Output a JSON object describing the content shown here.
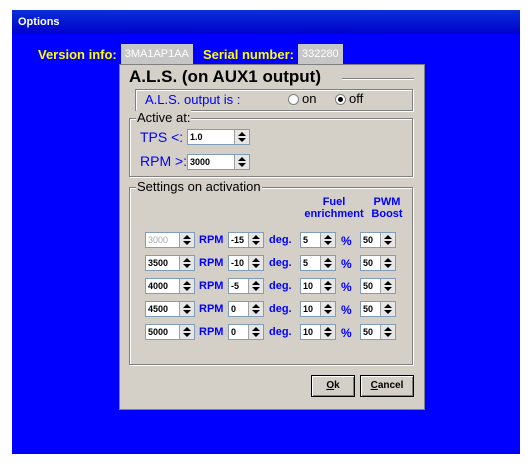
{
  "window": {
    "title": "Options"
  },
  "version": {
    "label": "Version info:",
    "value": "3MA1AP1AA"
  },
  "serial": {
    "label": "Serial number:",
    "value": "332280"
  },
  "als": {
    "title": "A.L.S. (on AUX1 output)",
    "output_label": "A.L.S. output is :",
    "on_label": "on",
    "off_label": "off",
    "selected": "off"
  },
  "active": {
    "legend": "Active at:",
    "tps_label": "TPS <:",
    "tps_value": "1.0",
    "rpm_label": "RPM >:",
    "rpm_value": "3000"
  },
  "settings": {
    "legend": "Settings on activation",
    "hdr_fuel_1": "Fuel",
    "hdr_fuel_2": "enrichment",
    "hdr_pwm_1": "PWM",
    "hdr_pwm_2": "Boost",
    "unit_rpm": "RPM",
    "unit_deg": "deg.",
    "unit_pct": "%",
    "rows": [
      {
        "rpm": "3000",
        "deg": "-15",
        "fuel": "5",
        "pwm": "50"
      },
      {
        "rpm": "3500",
        "deg": "-10",
        "fuel": "5",
        "pwm": "50"
      },
      {
        "rpm": "4000",
        "deg": "-5",
        "fuel": "10",
        "pwm": "50"
      },
      {
        "rpm": "4500",
        "deg": "0",
        "fuel": "10",
        "pwm": "50"
      },
      {
        "rpm": "5000",
        "deg": "0",
        "fuel": "10",
        "pwm": "50"
      }
    ]
  },
  "buttons": {
    "ok_u": "O",
    "ok_rest": "k",
    "cancel_u": "C",
    "cancel_rest": "ancel"
  },
  "colors": {
    "background": "#0000ff",
    "label_yellow": "#ffff00",
    "title_bar": "#0a2fd8"
  }
}
